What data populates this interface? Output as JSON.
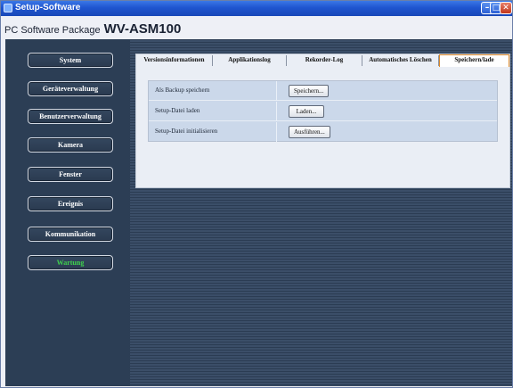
{
  "window": {
    "title": "Setup-Software",
    "package_label": "PC Software Package",
    "model": "WV-ASM100",
    "min_glyph": "–",
    "max_glyph": "□",
    "close_glyph": "✕"
  },
  "sidebar": {
    "items": [
      {
        "label": "System",
        "active": false
      },
      {
        "label": "Geräteverwaltung",
        "active": false
      },
      {
        "label": "Benutzerverwaltung",
        "active": false
      },
      {
        "label": "Kamera",
        "active": false
      },
      {
        "label": "Fenster",
        "active": false
      },
      {
        "label": "Ereignis",
        "active": false
      },
      {
        "label": "Kommunikation",
        "active": false
      },
      {
        "label": "Wartung",
        "active": true
      }
    ],
    "active_color": "#3fd24d"
  },
  "tabs": [
    {
      "label": "Versionsinformationen",
      "active": false
    },
    {
      "label": "Applikationslog",
      "active": false
    },
    {
      "label": "Rekorder-Log",
      "active": false
    },
    {
      "label": "Automatisches Löschen",
      "active": false
    },
    {
      "label": "Speichern/lade",
      "active": true
    }
  ],
  "options": [
    {
      "label": "Als Backup speichern",
      "button": "Speichern..."
    },
    {
      "label": "Setup-Datei laden",
      "button": "Laden..."
    },
    {
      "label": "Setup-Datei initialisieren",
      "button": "Ausführen..."
    }
  ],
  "colors": {
    "titlebar": "#1f55cf",
    "sidebar_bg": "#2c3e55",
    "active_tab_border": "#e08b2a"
  }
}
